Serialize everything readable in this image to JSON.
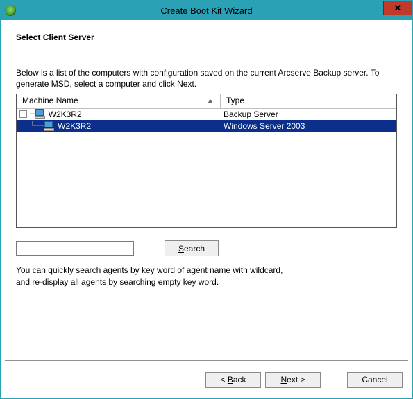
{
  "window": {
    "title": "Create Boot Kit Wizard"
  },
  "page": {
    "heading": "Select Client Server",
    "description": "Below is a list of the computers with configuration saved on the current Arcserve Backup server. To generate MSD, select a computer and click Next.",
    "hint_line1": "You can quickly search agents by key word of agent name with wildcard,",
    "hint_line2": "and re-display all agents by searching empty key word."
  },
  "listview": {
    "columns": {
      "name": "Machine Name",
      "type": "Type"
    },
    "rows": [
      {
        "name": "W2K3R2",
        "type": "Backup Server",
        "level": 0,
        "selected": false
      },
      {
        "name": "W2K3R2",
        "type": "Windows Server 2003",
        "level": 1,
        "selected": true
      }
    ]
  },
  "search": {
    "value": "",
    "button_label": "Search",
    "button_accel": "S"
  },
  "footer": {
    "back": {
      "label": "Back",
      "accel": "B"
    },
    "next": {
      "label": "Next",
      "accel": "N"
    },
    "cancel": {
      "label": "Cancel"
    }
  }
}
